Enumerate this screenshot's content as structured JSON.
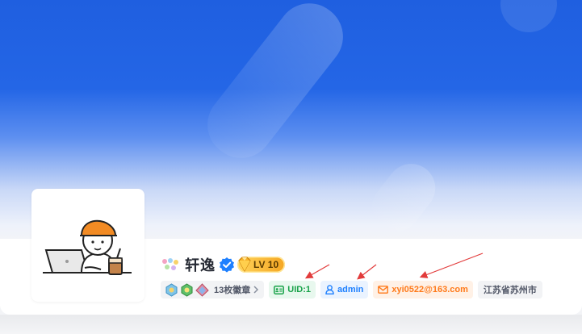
{
  "profile": {
    "username": "轩逸",
    "level_label": "LV 10",
    "badges_label": "13枚徽章",
    "uid_label": "UID:1",
    "user_label": "admin",
    "email_label": "xyi0522@163.com",
    "location_label": "江苏省苏州市"
  },
  "colors": {
    "banner_blue": "#2466e6",
    "uid_green": "#1aa34a",
    "user_blue": "#1e80ff",
    "email_orange": "#ff7a1a",
    "annotation_red": "#e23b3b"
  },
  "icons": {
    "verified": "verified-badge-icon",
    "level": "gem-icon",
    "uid": "id-card-icon",
    "user": "user-icon",
    "email": "mail-icon",
    "chevron": "chevron-right-icon"
  }
}
